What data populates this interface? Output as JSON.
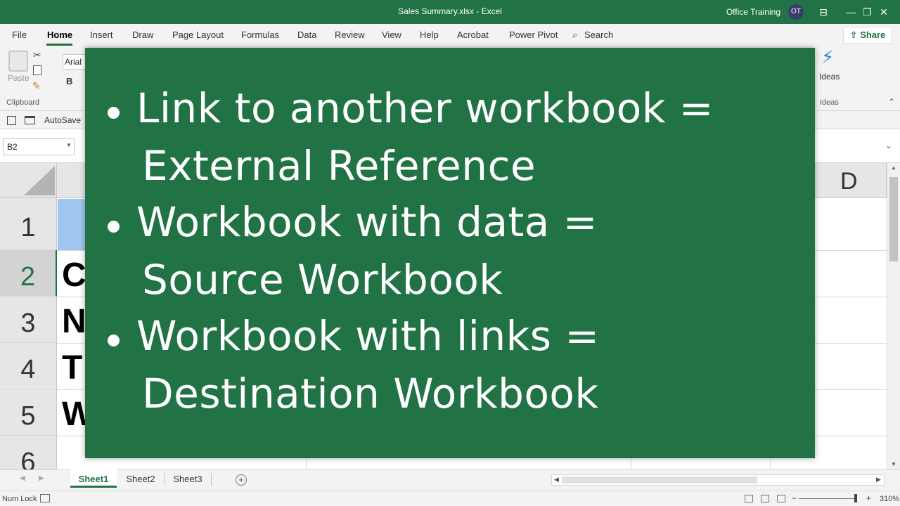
{
  "window": {
    "title": "Sales Summary.xlsx  -  Excel",
    "user_name": "Office Training",
    "avatar_initials": "OT",
    "accent": "#217346"
  },
  "ribbon": {
    "tabs": [
      "File",
      "Home",
      "Insert",
      "Draw",
      "Page Layout",
      "Formulas",
      "Data",
      "Review",
      "View",
      "Help",
      "Acrobat",
      "Power Pivot",
      "Search"
    ],
    "active_tab": "Home",
    "share_label": "Share",
    "paste_label": "Paste",
    "clipboard_group": "Clipboard",
    "font_name": "Arial",
    "bold_label": "B",
    "ideas_label": "Ideas",
    "ideas_group": "Ideas"
  },
  "qat": {
    "autosave_label": "AutoSave"
  },
  "formula_bar": {
    "name_box": "B2"
  },
  "grid": {
    "columns_visible": [
      "D"
    ],
    "rows": [
      "1",
      "2",
      "3",
      "4",
      "5",
      "6"
    ],
    "active_row": "2",
    "cells_col_a": [
      "C",
      "N",
      "T",
      "W"
    ]
  },
  "sheets": {
    "tabs": [
      "Sheet1",
      "Sheet2",
      "Sheet3"
    ],
    "active": "Sheet1"
  },
  "status": {
    "num_lock": "Num Lock",
    "zoom": "310%"
  },
  "slide": {
    "bullets": [
      {
        "line1": "Link to another workbook =",
        "line2": "External Reference"
      },
      {
        "line1": "Workbook with data =",
        "line2": "Source Workbook"
      },
      {
        "line1": "Workbook with links =",
        "line2": "Destination Workbook"
      }
    ],
    "background": "#217346"
  }
}
